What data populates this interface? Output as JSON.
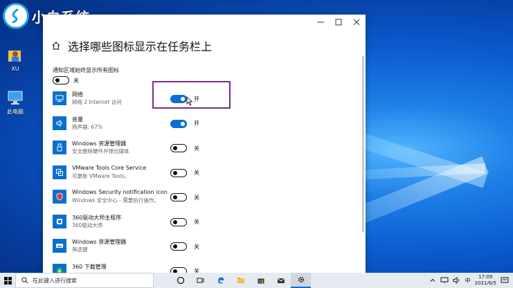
{
  "desktop": {
    "brand": "小白系统",
    "icons": [
      {
        "label": "XU"
      },
      {
        "label": "此电脑"
      }
    ]
  },
  "window": {
    "title": "选择哪些图标显示在任务栏上",
    "always_show_label": "通知区域始终显示所有图标",
    "always_show_state": "关",
    "items": [
      {
        "name": "网络",
        "desc": "网络 2 Internet 访问",
        "state": "开",
        "icon": "network-icon"
      },
      {
        "name": "音量",
        "desc": "扬声器: 67%",
        "state": "开",
        "icon": "volume-icon"
      },
      {
        "name": "Windows 资源管理器",
        "desc": "安全删除硬件并弹出媒体",
        "state": "关",
        "icon": "usb-icon"
      },
      {
        "name": "VMware Tools Core Service",
        "desc": "可更新 VMware Tools。",
        "state": "关",
        "icon": "vmware-icon"
      },
      {
        "name": "Windows Security notification icon",
        "desc": "Windows 安全中心 - 需要执行操作。",
        "state": "关",
        "icon": "shield-icon"
      },
      {
        "name": "360驱动大师主程序",
        "desc": "360驱动大师",
        "state": "关",
        "icon": "driver-icon"
      },
      {
        "name": "Windows 资源管理器",
        "desc": "筛选键",
        "state": "关",
        "icon": "keyboard-icon"
      },
      {
        "name": "360 下载管理",
        "desc": "",
        "state": "关",
        "icon": "download-icon"
      }
    ]
  },
  "taskbar": {
    "search_placeholder": "在此键入进行搜索",
    "ime": "中",
    "time": "17:09",
    "date": "2021/6/5"
  },
  "colors": {
    "accent": "#0a6fd1",
    "highlight": "#7b2a8c"
  }
}
